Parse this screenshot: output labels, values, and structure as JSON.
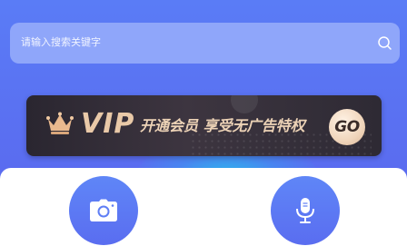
{
  "search": {
    "placeholder": "请输入搜索关键字",
    "icon": "search-icon"
  },
  "vip_banner": {
    "mark": "VIP",
    "text": "开通会员 享受无广告特权",
    "go_label": "GO",
    "icon": "crown-icon",
    "colors": {
      "gold": "#e9c9a8",
      "background": "#2e2a34"
    }
  },
  "actions": [
    {
      "icon": "camera-icon"
    },
    {
      "icon": "microphone-icon"
    }
  ],
  "colors": {
    "brand": "#5a6ff1",
    "accent_cyan": "#28beeb"
  }
}
